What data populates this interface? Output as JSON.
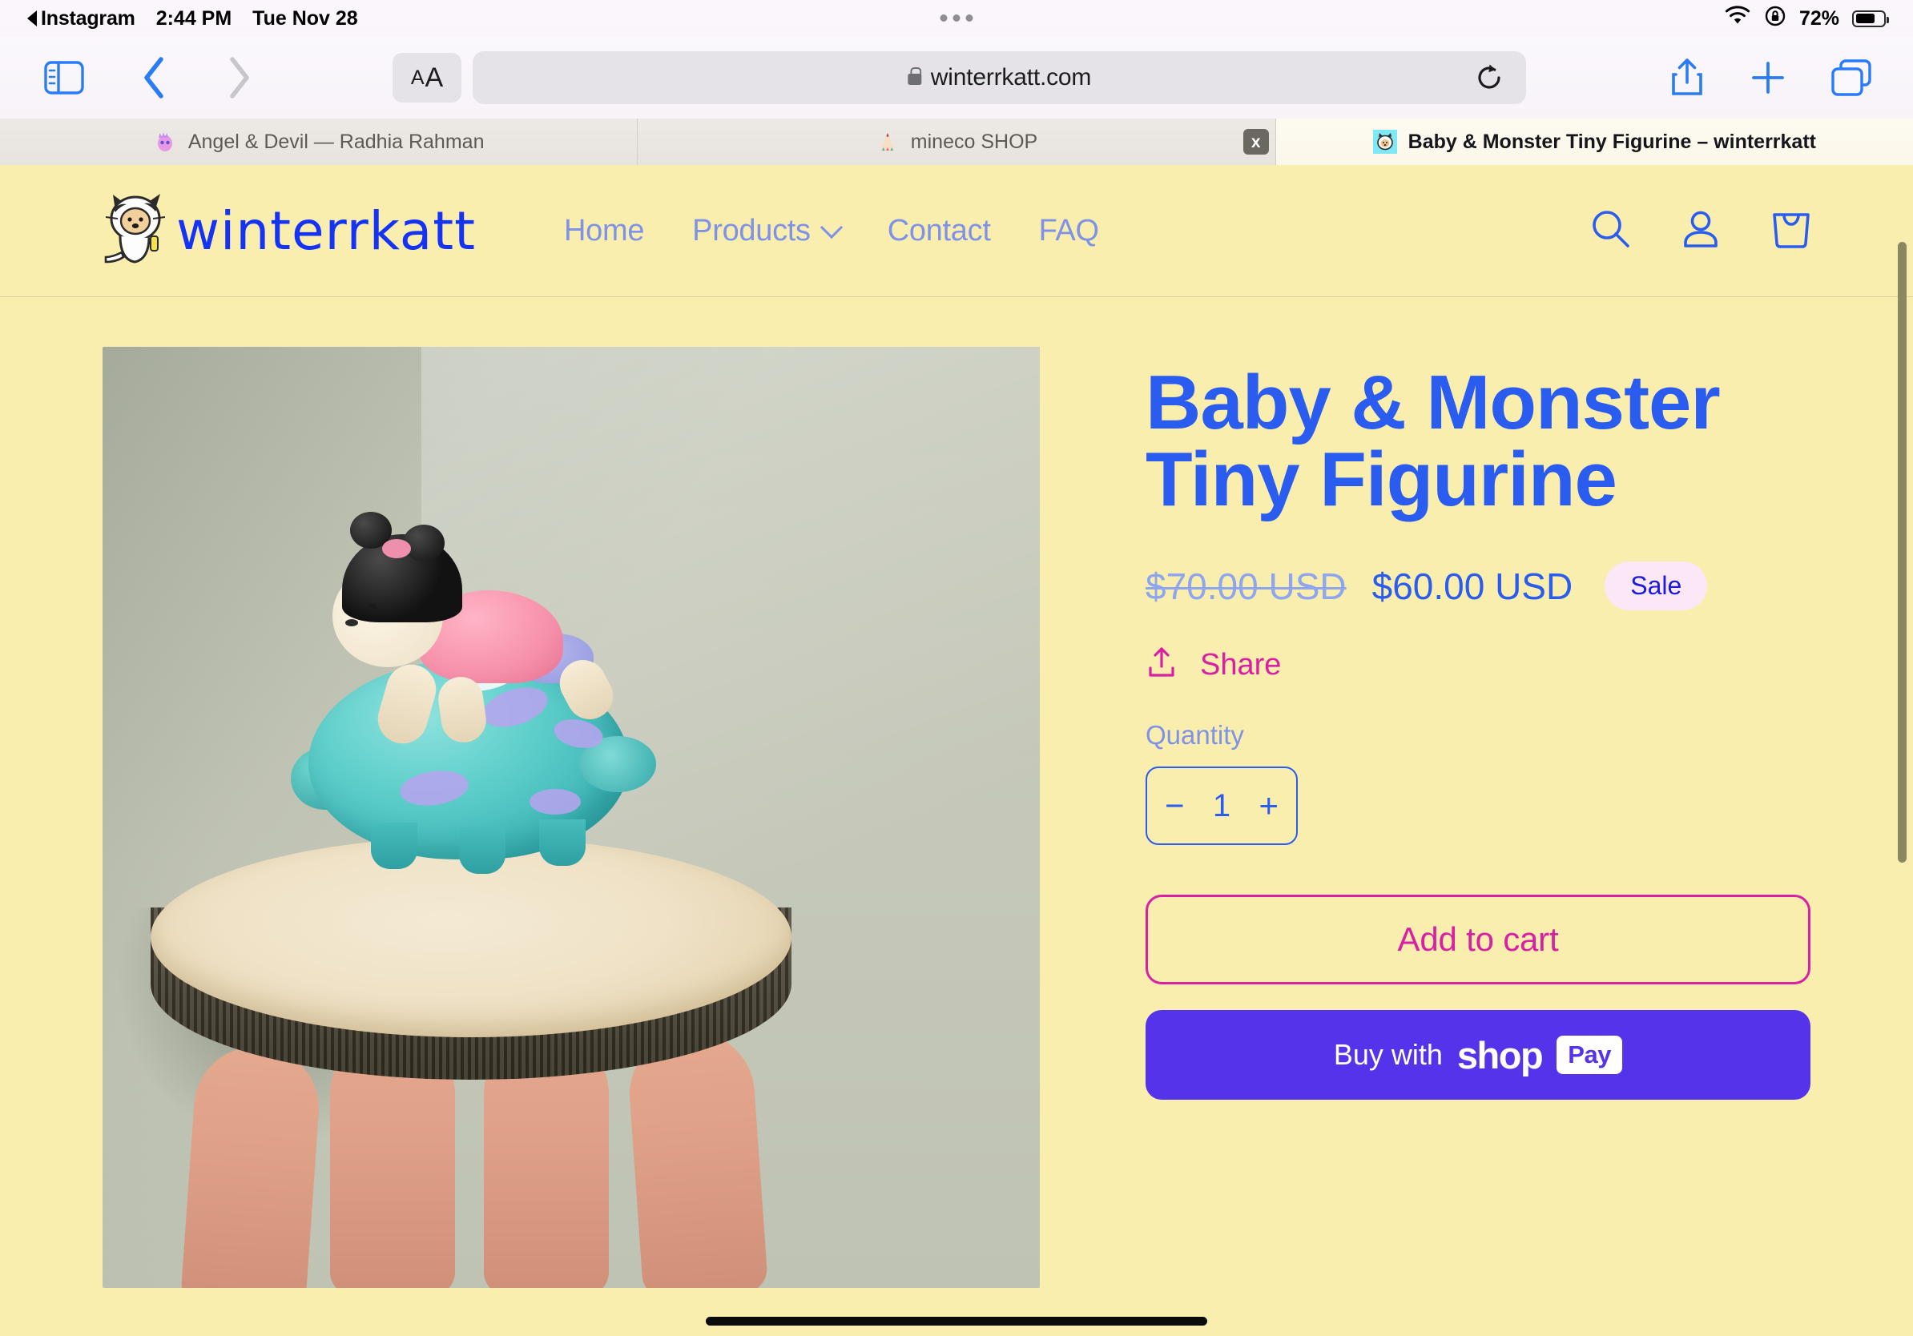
{
  "statusbar": {
    "back_app": "Instagram",
    "time": "2:44 PM",
    "date": "Tue Nov 28",
    "battery_percent": "72%",
    "wifi_icon": "wifi-icon",
    "rotation_lock_icon": "rotation-lock-icon",
    "battery_icon": "battery-icon"
  },
  "toolbar": {
    "sidebar_icon": "sidebar-toggle-icon",
    "back_icon": "back-chevron-icon",
    "forward_icon": "forward-chevron-icon",
    "text_size_label_small": "A",
    "text_size_label_large": "A",
    "url": "winterrkatt.com",
    "lock_icon": "lock-icon",
    "reload_icon": "reload-icon",
    "share_icon": "share-icon",
    "new_tab_icon": "plus-icon",
    "tabs_icon": "tab-overview-icon"
  },
  "tabs": [
    {
      "title": "Angel & Devil — Radhia Rahman",
      "favicon": "purple-devil-favicon",
      "active": false,
      "closable": false
    },
    {
      "title": "mineco SHOP",
      "favicon": "tent-favicon",
      "active": false,
      "closable": true,
      "close_label": "x"
    },
    {
      "title": "Baby & Monster Tiny Figurine – winterrkatt",
      "favicon": "cyan-cat-favicon",
      "active": true,
      "closable": false
    }
  ],
  "site": {
    "brand": "winterrkatt",
    "logo_icon": "winterrkatt-cat-logo",
    "nav": [
      {
        "label": "Home",
        "has_dropdown": false
      },
      {
        "label": "Products",
        "has_dropdown": true
      },
      {
        "label": "Contact",
        "has_dropdown": false
      },
      {
        "label": "FAQ",
        "has_dropdown": false
      }
    ],
    "header_icons": [
      {
        "name": "search-icon"
      },
      {
        "name": "account-icon"
      },
      {
        "name": "cart-icon"
      }
    ],
    "colors": {
      "page_bg": "#faeeae",
      "brand_blue": "#1433f5",
      "title_blue": "#2a5cf0",
      "nav_blue": "#7e92e8",
      "accent_pink": "#d81fa5",
      "sale_badge_bg": "#fbe7f5",
      "shoppay_purple": "#5433eb"
    }
  },
  "product": {
    "title": "Baby & Monster Tiny Figurine",
    "price_compare": "$70.00 USD",
    "price_current": "$60.00 USD",
    "sale_badge": "Sale",
    "share_label": "Share",
    "share_icon": "share-up-icon",
    "quantity_label": "Quantity",
    "quantity_value": "1",
    "quantity_decrease": "−",
    "quantity_increase": "+",
    "add_to_cart_label": "Add to cart",
    "buy_with_label": "Buy with",
    "shop_word": "shop",
    "pay_word": "Pay",
    "image_alt": "Teal monster figurine with baby on top, on a wood slice held in a hand"
  }
}
